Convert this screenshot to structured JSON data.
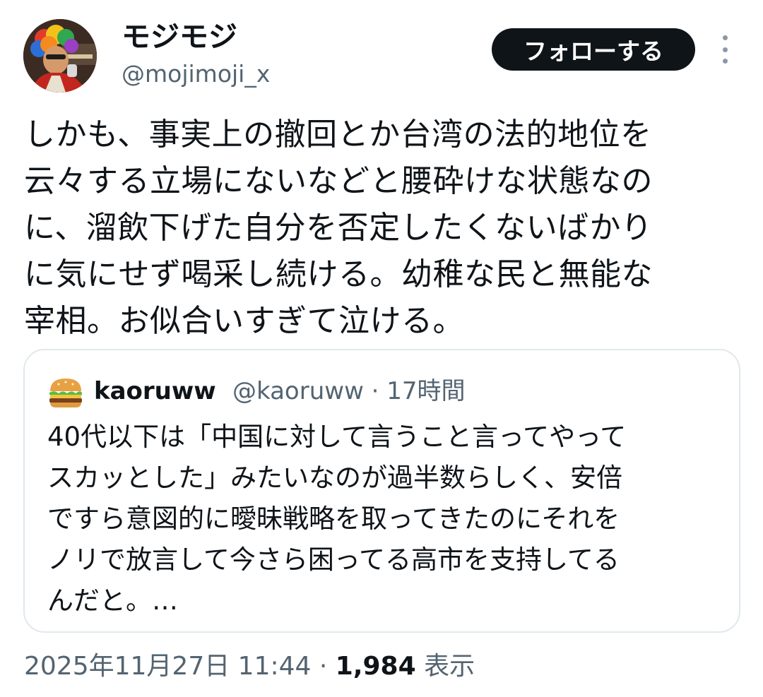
{
  "author": {
    "display_name": "モジモジ",
    "handle": "@mojimoji_x",
    "avatar_icon": "user-avatar"
  },
  "follow_button": {
    "label": "フォローする"
  },
  "more_icon": "more-vertical-icon",
  "tweet": {
    "lines": [
      "しかも、事実上の撤回とか台湾の法的地位を",
      "云々する立場にないなどと腰砕けな状態なの",
      "に、溜飲下げた自分を否定したくないばかり",
      "に気にせず喝采し続ける。幼稚な民と無能な",
      "宰相。お似合いすぎて泣ける。"
    ]
  },
  "quote": {
    "avatar_icon": "hamburger-emoji-icon",
    "display_name": "kaoruww",
    "meta": "@kaoruww · 17時間",
    "lines": [
      "40代以下は「中国に対して言うこと言ってやって",
      "スカッとした」みたいなのが過半数らしく、安倍",
      "ですら意図的に曖昧戦略を取ってきたのにそれを",
      "ノリで放言して今さら困ってる高市を支持してる",
      "んだと。…"
    ]
  },
  "footer": {
    "timestamp": "2025年11月27日 11:44 · ",
    "views_count": "1,984",
    "views_label": " 表示"
  },
  "colors": {
    "primary_text": "#0f1419",
    "secondary_text": "#536471",
    "border": "#e1e8ed",
    "button_bg": "#0f1419"
  }
}
